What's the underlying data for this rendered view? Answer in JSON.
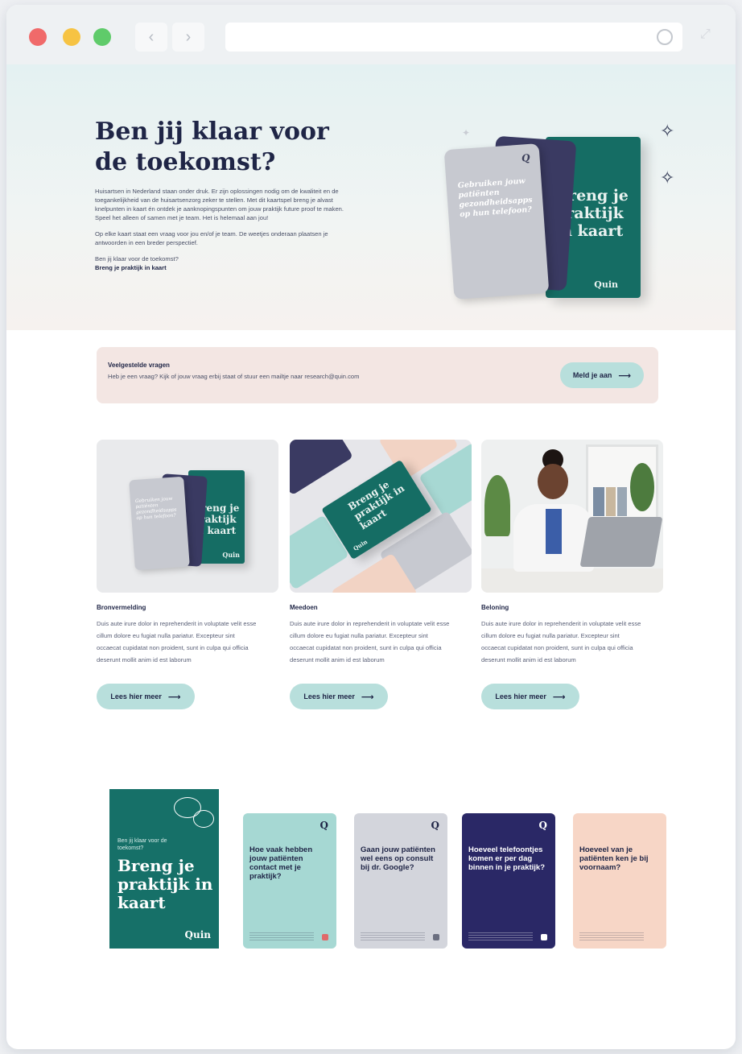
{
  "hero": {
    "title": "Ben jij klaar voor de toekomst?",
    "paragraph1": "Huisartsen in Nederland staan onder druk. Er zijn oplossingen nodig om de kwaliteit en de toegankelijkheid van de huisartsenzorg zeker te stellen. Met dit kaartspel breng je alvast knelpunten in kaart én ontdek je aanknopingspunten om jouw praktijk future proof te maken. Speel het alleen of samen met je team. Het is helemaal aan jou!",
    "paragraph2": "Op elke kaart staat een vraag voor jou en/of je team. De weetjes onderaan plaatsen je antwoorden in een breder perspectief.",
    "lead": "Ben jij klaar voor de toekomst?",
    "tagline": "Breng je praktijk in kaart"
  },
  "illustration": {
    "card_question": "Gebruiken jouw patiënten gezondheidsapps op hun telefoon?",
    "box_title": "Breng je praktijk in kaart",
    "brand": "Quin"
  },
  "faq": {
    "title": "Veelgestelde vragen",
    "text": "Heb je een vraag? Kijk of jouw vraag erbij staat of stuur een mailtje naar research@quin.com",
    "button": "Meld je aan"
  },
  "columns": [
    {
      "title": "Bronvermelding",
      "text": "Duis aute irure dolor in reprehenderit in voluptate velit esse cillum dolore eu fugiat nulla pariatur. Excepteur sint occaecat cupidatat non proident, sunt in culpa qui officia deserunt mollit anim id est laborum",
      "button": "Lees hier meer",
      "image_card_question": "Gebruiken jouw patiënten gezondheidsapps op hun telefoon?",
      "image_box_title": "Breng je praktijk in kaart",
      "image_brand": "Quin"
    },
    {
      "title": "Meedoen",
      "text": "Duis aute irure dolor in reprehenderit in voluptate velit esse cillum dolore eu fugiat nulla pariatur. Excepteur sint occaecat cupidatat non proident, sunt in culpa qui officia deserunt mollit anim id est laborum",
      "button": "Lees hier meer",
      "image_box_title": "Breng je praktijk in kaart",
      "image_brand": "Quin"
    },
    {
      "title": "Beloning",
      "text": "Duis aute irure dolor in reprehenderit in voluptate velit esse cillum dolore eu fugiat nulla pariatur. Excepteur sint occaecat cupidatat non proident, sunt in culpa qui officia deserunt mollit anim id est laborum",
      "button": "Lees hier meer"
    }
  ],
  "cover": {
    "small": "Ben jij klaar voor de toekomst?",
    "big": "Breng je praktijk in kaart",
    "brand": "Quin"
  },
  "cards": [
    {
      "question": "Hoe vaak hebben jouw patiënten contact met je praktijk?",
      "bg": "#a6d8d3",
      "fg": "#1f2546"
    },
    {
      "question": "Gaan jouw patiënten wel eens op consult bij dr. Google?",
      "bg": "#d3d5dc",
      "fg": "#1f2546"
    },
    {
      "question": "Hoeveel telefoontjes komen er per dag binnen in je praktijk?",
      "bg": "#2a2866",
      "fg": "#ffffff"
    },
    {
      "question": "Hoeveel van je patiënten ken je bij voornaam?",
      "bg": "#f7d6c6",
      "fg": "#1f2546"
    }
  ],
  "colors": {
    "teal": "#167068",
    "button": "#b8dfdc",
    "navy": "#1f2546",
    "faq_bg": "#f3e6e3"
  }
}
